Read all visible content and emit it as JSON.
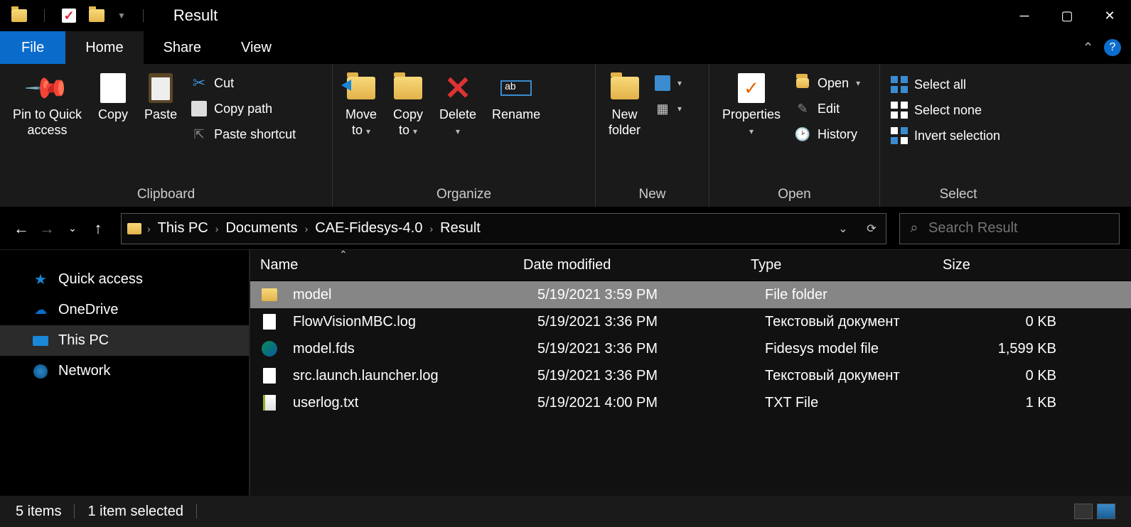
{
  "window": {
    "title": "Result"
  },
  "menubar": {
    "file": "File",
    "home": "Home",
    "share": "Share",
    "view": "View"
  },
  "ribbon": {
    "pin": "Pin to Quick\naccess",
    "copy": "Copy",
    "paste": "Paste",
    "cut": "Cut",
    "copy_path": "Copy path",
    "paste_shortcut": "Paste shortcut",
    "group_clipboard": "Clipboard",
    "move_to": "Move\nto",
    "copy_to": "Copy\nto",
    "delete": "Delete",
    "rename": "Rename",
    "group_organize": "Organize",
    "new_folder": "New\nfolder",
    "group_new": "New",
    "properties": "Properties",
    "open": "Open",
    "edit": "Edit",
    "history": "History",
    "group_open": "Open",
    "select_all": "Select all",
    "select_none": "Select none",
    "invert_selection": "Invert selection",
    "group_select": "Select"
  },
  "breadcrumbs": [
    "This PC",
    "Documents",
    "CAE-Fidesys-4.0",
    "Result"
  ],
  "search": {
    "placeholder": "Search Result"
  },
  "sidebar": {
    "quick_access": "Quick access",
    "onedrive": "OneDrive",
    "this_pc": "This PC",
    "network": "Network"
  },
  "columns": {
    "name": "Name",
    "date": "Date modified",
    "type": "Type",
    "size": "Size"
  },
  "files": [
    {
      "name": "model",
      "date": "5/19/2021 3:59 PM",
      "type": "File folder",
      "size": "",
      "icon": "folder",
      "selected": true
    },
    {
      "name": "FlowVisionMBC.log",
      "date": "5/19/2021 3:36 PM",
      "type": "Текстовый документ",
      "size": "0 KB",
      "icon": "doc"
    },
    {
      "name": "model.fds",
      "date": "5/19/2021 3:36 PM",
      "type": "Fidesys model file",
      "size": "1,599 KB",
      "icon": "fds"
    },
    {
      "name": "src.launch.launcher.log",
      "date": "5/19/2021 3:36 PM",
      "type": "Текстовый документ",
      "size": "0 KB",
      "icon": "doc"
    },
    {
      "name": "userlog.txt",
      "date": "5/19/2021 4:00 PM",
      "type": "TXT File",
      "size": "1 KB",
      "icon": "txt"
    }
  ],
  "status": {
    "items": "5 items",
    "selected": "1 item selected"
  }
}
